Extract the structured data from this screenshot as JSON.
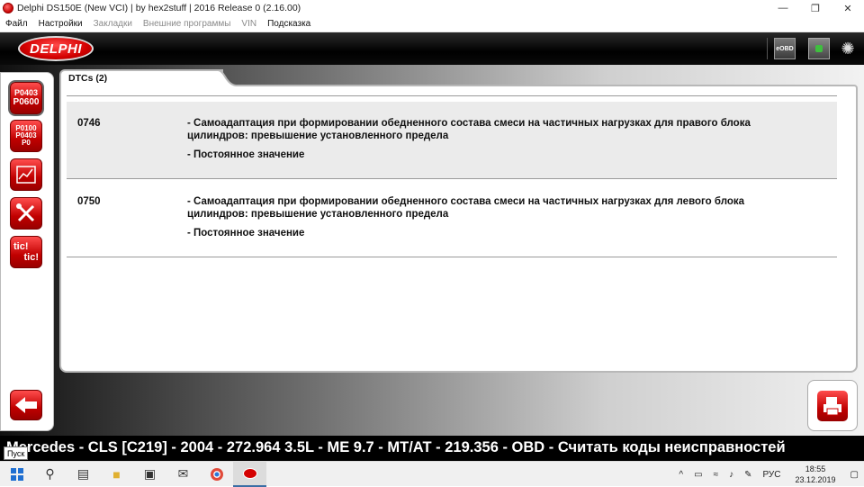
{
  "window": {
    "title": "Delphi DS150E (New VCI) | by hex2stuff | 2016 Release 0 (2.16.00)",
    "minimize": "—",
    "maximize": "❐",
    "close": "✕"
  },
  "menu": [
    {
      "label": "Файл",
      "enabled": true
    },
    {
      "label": "Настройки",
      "enabled": true
    },
    {
      "label": "Закладки",
      "enabled": false
    },
    {
      "label": "Внешние программы",
      "enabled": false
    },
    {
      "label": "VIN",
      "enabled": false
    },
    {
      "label": "Подсказка",
      "enabled": true
    }
  ],
  "header": {
    "logo_text": "DELPHI",
    "eobd_label": "eOBD"
  },
  "sidebar": {
    "btn_read_codes_line1": "P0403",
    "btn_read_codes_line2": "P0600",
    "btn_clear_codes_line1": "P0100",
    "btn_clear_codes_line2": "P0403",
    "btn_clear_codes_line3": "P0",
    "btn_tic_line1": "tic!",
    "btn_tic_line2": "tic!"
  },
  "tab": {
    "label": "DTCs (2)"
  },
  "dtcs": [
    {
      "code": "0746",
      "description": "- Самоадаптация при формировании обедненного состава смеси на частичных нагрузках для правого блока цилиндров: превышение установленного предела",
      "status": "- Постоянное значение"
    },
    {
      "code": "0750",
      "description": "- Самоадаптация при формировании обедненного состава смеси на частичных нагрузках для левого блока цилиндров: превышение установленного предела",
      "status": "- Постоянное значение"
    }
  ],
  "statusbar": {
    "text": "Mercedes - CLS [C219] - 2004 - 272.964 3.5L - ME 9.7 - MT/AT - 219.356 - OBD - Считать коды неисправностей"
  },
  "tooltip": {
    "text": "Пуск"
  },
  "taskbar": {
    "language": "РУС",
    "time": "18:55",
    "date": "23.12.2019"
  },
  "colors": {
    "accent_red": "#d40000",
    "selected_row": "#ebebeb"
  }
}
